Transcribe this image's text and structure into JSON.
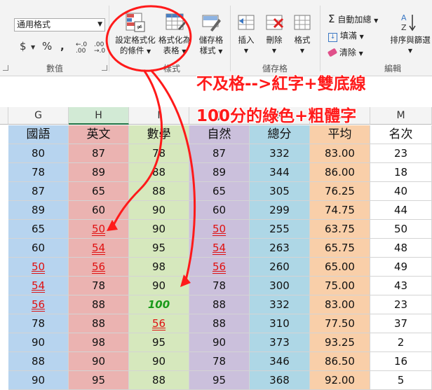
{
  "ribbon": {
    "number_format_value": "通用格式",
    "currency_symbol": "$",
    "percent_symbol": "%",
    "comma_symbol": ",",
    "dec_increase": "←.0 .00",
    "dec_decrease": ".00 →.0",
    "number_group_label": "數值",
    "cond_format_line1": "設定格式化",
    "cond_format_line2": "的條件",
    "format_table_line1": "格式化為",
    "format_table_line2": "表格",
    "cell_styles_line1": "儲存格",
    "cell_styles_line2": "樣式",
    "styles_group_label": "樣式",
    "insert_label": "插入",
    "delete_label": "刪除",
    "format_label": "格式",
    "cells_group_label": "儲存格",
    "autosum_label": "自動加總",
    "fill_label": "填滿",
    "clear_label": "清除",
    "sort_filter_line1": "排序與篩選",
    "editing_group_label": "編輯"
  },
  "annotations": {
    "note1": "不及格-->紅字+雙底線",
    "note2": "100分的綠色+粗體字"
  },
  "colors": {
    "chinese": "#b7d4ef",
    "english": "#ebb3b1",
    "math": "#d6e8bd",
    "science": "#cbc0dc",
    "total": "#aed7e6",
    "average": "#f9cfa9",
    "rank": "#ffffff",
    "fail_text": "#e01010",
    "perfect_text": "#1a9a1a",
    "annotation": "#ff1a1a"
  },
  "sheet": {
    "column_letters": [
      "G",
      "H",
      "I",
      "J",
      "K",
      "L",
      "M"
    ],
    "headers": [
      "國語",
      "英文",
      "數學",
      "自然",
      "總分",
      "平均",
      "名次"
    ],
    "rows": [
      [
        "80",
        "87",
        "78",
        "87",
        "332",
        "83.00",
        "23"
      ],
      [
        "78",
        "89",
        "88",
        "89",
        "344",
        "86.00",
        "18"
      ],
      [
        "87",
        "65",
        "88",
        "65",
        "305",
        "76.25",
        "40"
      ],
      [
        "89",
        "60",
        "90",
        "60",
        "299",
        "74.75",
        "44"
      ],
      [
        "65",
        "50",
        "90",
        "50",
        "255",
        "63.75",
        "50"
      ],
      [
        "60",
        "54",
        "95",
        "54",
        "263",
        "65.75",
        "48"
      ],
      [
        "50",
        "56",
        "98",
        "56",
        "260",
        "65.00",
        "49"
      ],
      [
        "54",
        "78",
        "90",
        "78",
        "300",
        "75.00",
        "43"
      ],
      [
        "56",
        "88",
        "100",
        "88",
        "332",
        "83.00",
        "23"
      ],
      [
        "78",
        "88",
        "56",
        "88",
        "310",
        "77.50",
        "37"
      ],
      [
        "90",
        "98",
        "95",
        "90",
        "373",
        "93.25",
        "2"
      ],
      [
        "88",
        "90",
        "90",
        "78",
        "346",
        "86.50",
        "16"
      ],
      [
        "90",
        "95",
        "88",
        "95",
        "368",
        "92.00",
        "5"
      ]
    ]
  }
}
